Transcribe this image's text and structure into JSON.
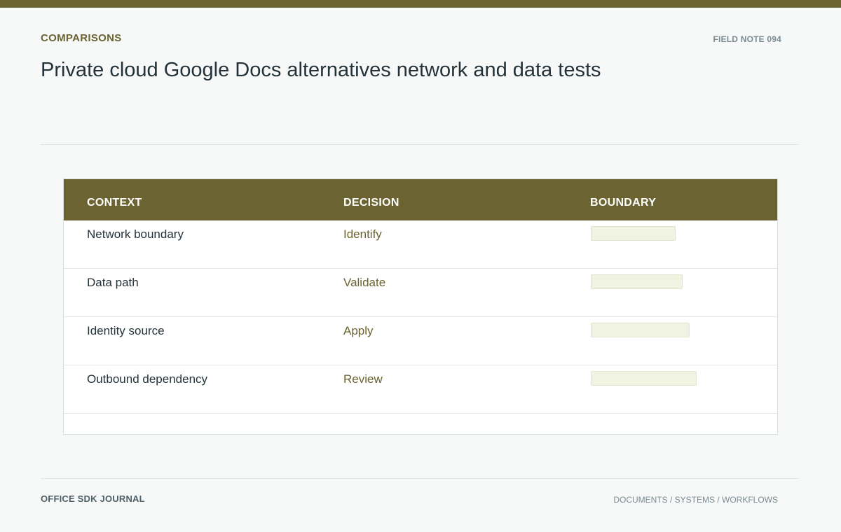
{
  "header": {
    "eyebrow": "COMPARISONS",
    "field_note": "FIELD NOTE 094",
    "title": "Private cloud Google Docs alternatives network and data tests"
  },
  "table": {
    "columns": [
      "CONTEXT",
      "DECISION",
      "BOUNDARY"
    ],
    "rows": [
      {
        "context": "Network boundary",
        "decision": "Identify"
      },
      {
        "context": "Data path",
        "decision": "Validate"
      },
      {
        "context": "Identity source",
        "decision": "Apply"
      },
      {
        "context": "Outbound dependency",
        "decision": "Review"
      }
    ]
  },
  "footer": {
    "brand": "OFFICE SDK JOURNAL",
    "sections": "DOCUMENTS / SYSTEMS / WORKFLOWS"
  },
  "colors": {
    "accent": "#6b6331",
    "boundary_fill": "#f1f3e2"
  }
}
